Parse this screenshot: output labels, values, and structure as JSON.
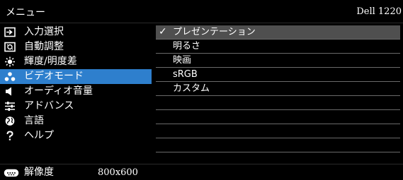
{
  "header": {
    "menu_title": "メニュー",
    "model": "Dell 1220"
  },
  "menu": {
    "items": [
      {
        "label": "入力選択",
        "icon": "input-select-icon"
      },
      {
        "label": "自動調整",
        "icon": "auto-adjust-icon"
      },
      {
        "label": "輝度/明度差",
        "icon": "brightness-icon"
      },
      {
        "label": "ビデオモード",
        "icon": "video-mode-icon",
        "selected": true
      },
      {
        "label": "オーディオ音量",
        "icon": "speaker-icon"
      },
      {
        "label": "アドバンス",
        "icon": "advanced-settings-icon"
      },
      {
        "label": "言語",
        "icon": "language-globe-icon"
      },
      {
        "label": "ヘルプ",
        "icon": "help-icon"
      }
    ]
  },
  "submenu": {
    "items": [
      {
        "label": "プレゼンテーション",
        "checked": true,
        "check_mark": "✓"
      },
      {
        "label": "明るさ"
      },
      {
        "label": "映画"
      },
      {
        "label": "sRGB"
      },
      {
        "label": "カスタム"
      },
      {
        "label": ""
      },
      {
        "label": ""
      },
      {
        "label": ""
      },
      {
        "label": ""
      }
    ]
  },
  "footer": {
    "resolution_label": "解像度",
    "resolution_value": "800x600",
    "icon": "display-connector-icon"
  },
  "colors": {
    "selected_item_bg": "#2e7fcd",
    "selected_row_bg": "#4f4f4f",
    "background": "#000000"
  }
}
